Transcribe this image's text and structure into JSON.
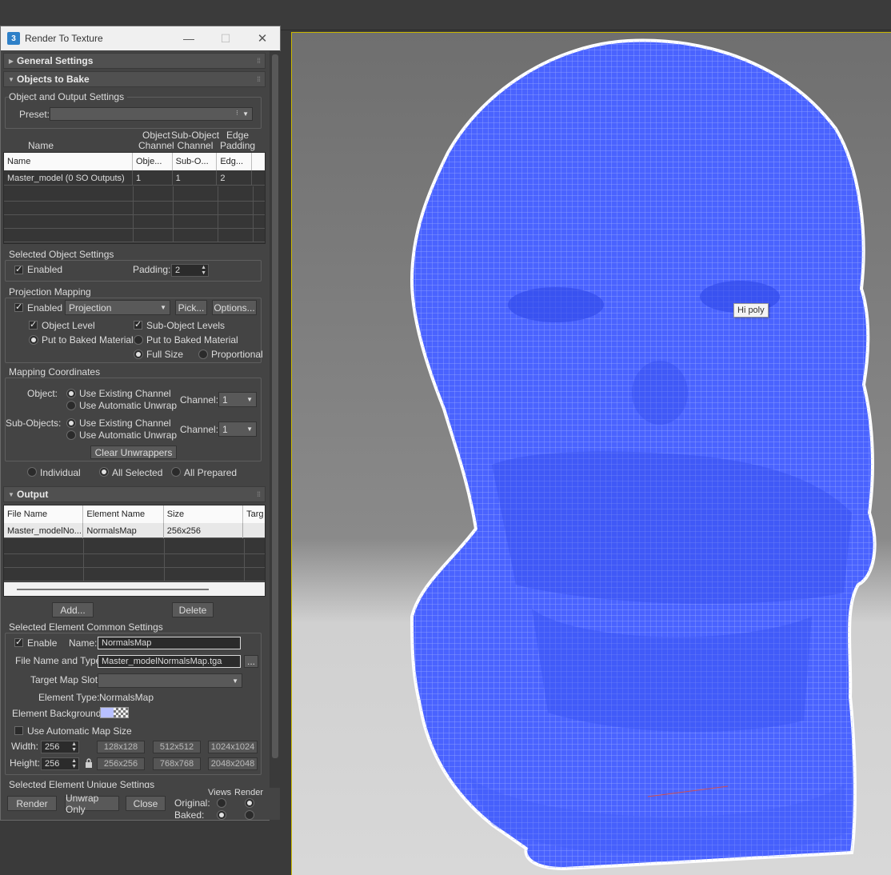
{
  "window": {
    "title": "Render To Texture",
    "app_icon": "3",
    "controls": {
      "minimize": "—",
      "maximize": "☐",
      "close": "✕"
    }
  },
  "rollouts": {
    "general": "General Settings",
    "objects": "Objects to Bake",
    "output": "Output",
    "grip": "⁞⁞"
  },
  "object_output": {
    "group_label": "Object and Output Settings",
    "preset_label": "Preset:",
    "preset_value": ""
  },
  "object_table": {
    "col_headers_top": [
      "Name",
      "Object\nChannel",
      "Sub-Object\nChannel",
      "Edge\nPadding"
    ],
    "columns": [
      "Name",
      "Obje...",
      "Sub-O...",
      "Edg..."
    ],
    "rows": [
      {
        "name": "Master_model (0 SO Outputs)",
        "obj": "1",
        "sub": "1",
        "edge": "2"
      }
    ]
  },
  "selected_object": {
    "group_label": "Selected Object Settings",
    "enabled_label": "Enabled",
    "enabled": true,
    "padding_label": "Padding:",
    "padding_value": "2"
  },
  "projection": {
    "group_label": "Projection Mapping",
    "enabled_label": "Enabled",
    "enabled": true,
    "mode": "Projection",
    "pick_label": "Pick...",
    "options_label": "Options...",
    "object_level_label": "Object Level",
    "sub_object_levels_label": "Sub-Object Levels",
    "put_baked_left": "Put to Baked Material",
    "put_baked_right": "Put to Baked Material",
    "full_size": "Full Size",
    "proportional": "Proportional"
  },
  "mapping": {
    "group_label": "Mapping Coordinates",
    "object_label": "Object:",
    "subobjects_label": "Sub-Objects:",
    "use_existing": "Use Existing Channel",
    "use_automatic": "Use Automatic Unwrap",
    "channel_label": "Channel:",
    "object_channel": "1",
    "sub_channel": "1",
    "clear_unwrappers": "Clear Unwrappers"
  },
  "scope": {
    "individual": "Individual",
    "all_selected": "All Selected",
    "all_prepared": "All Prepared",
    "selected": "all_selected"
  },
  "output_table": {
    "columns": [
      "File Name",
      "Element Name",
      "Size",
      "Targ"
    ],
    "rows": [
      {
        "file": "Master_modelNo...",
        "element": "NormalsMap",
        "size": "256x256",
        "target": ""
      }
    ]
  },
  "output_buttons": {
    "add": "Add...",
    "delete": "Delete"
  },
  "element_settings": {
    "group_label": "Selected Element Common Settings",
    "enable_label": "Enable",
    "enabled": true,
    "name_label": "Name:",
    "name_value": "NormalsMap",
    "file_label": "File Name and Type:",
    "file_value": "Master_modelNormalsMap.tga",
    "browse": "...",
    "target_slot_label": "Target Map Slot:",
    "target_slot_value": "",
    "element_type_label": "Element Type:",
    "element_type_value": "NormalsMap",
    "background_label": "Element Background:",
    "auto_map_size_label": "Use Automatic Map Size",
    "width_label": "Width:",
    "width_value": "256",
    "height_label": "Height:",
    "height_value": "256",
    "size_presets": [
      "128x128",
      "512x512",
      "1024x1024",
      "256x256",
      "768x768",
      "2048x2048"
    ]
  },
  "unique_settings_label": "Selected Element Unique Settings",
  "footer": {
    "render": "Render",
    "unwrap_only": "Unwrap Only",
    "close": "Close",
    "views": "Views",
    "render_col": "Render",
    "original": "Original:",
    "baked": "Baked:"
  },
  "viewport": {
    "tooltip": "Hi poly",
    "mesh_color": "#4a63ff",
    "background": "#7d7d7d"
  }
}
